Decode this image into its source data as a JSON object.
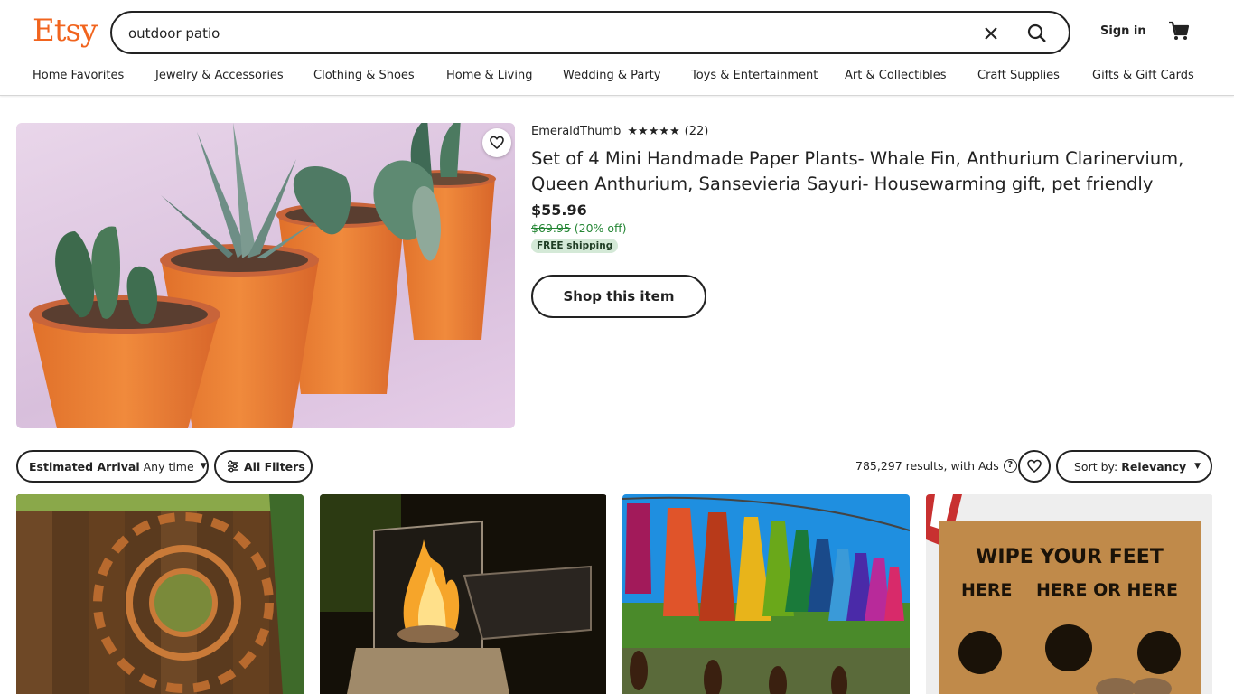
{
  "header": {
    "logo": "Etsy",
    "search_value": "outdoor patio",
    "sign_in": "Sign in"
  },
  "categories": [
    "Home Favorites",
    "Jewelry & Accessories",
    "Clothing & Shoes",
    "Home & Living",
    "Wedding & Party",
    "Toys & Entertainment",
    "Art & Collectibles",
    "Craft Supplies",
    "Gifts & Gift Cards"
  ],
  "ad": {
    "shop_name": "EmeraldThumb",
    "stars": "★★★★★",
    "rating_value": 5,
    "review_count": "(22)",
    "title": "Set of 4 Mini Handmade Paper Plants- Whale Fin, Anthurium Clarinervium, Queen Anthurium, Sansevieria Sayuri- Housewarming gift, pet friendly",
    "price": "$55.96",
    "original_price": "$69.95",
    "discount": "(20% off)",
    "shipping_badge": "FREE shipping",
    "shop_button": "Shop this item"
  },
  "filters": {
    "arrival_label": "Estimated Arrival",
    "arrival_value": "Any time",
    "all_filters": "All Filters",
    "results_text": "785,297 results, with Ads",
    "sort_label": "Sort by:",
    "sort_value": "Relevancy"
  },
  "listings": [
    {
      "image": "sun-metal-wall-art"
    },
    {
      "image": "tabletop-fire-pit"
    },
    {
      "image": "glass-bottle-wind-chimes"
    },
    {
      "image": "wipe-your-feet-doormat",
      "image_text_1": "WIPE YOUR FEET",
      "image_text_2": "HERE    HERE OR HERE"
    }
  ],
  "colors": {
    "brand": "#f1641e",
    "sale_green": "#258635",
    "shipping_badge_bg": "#d4e9d7"
  }
}
